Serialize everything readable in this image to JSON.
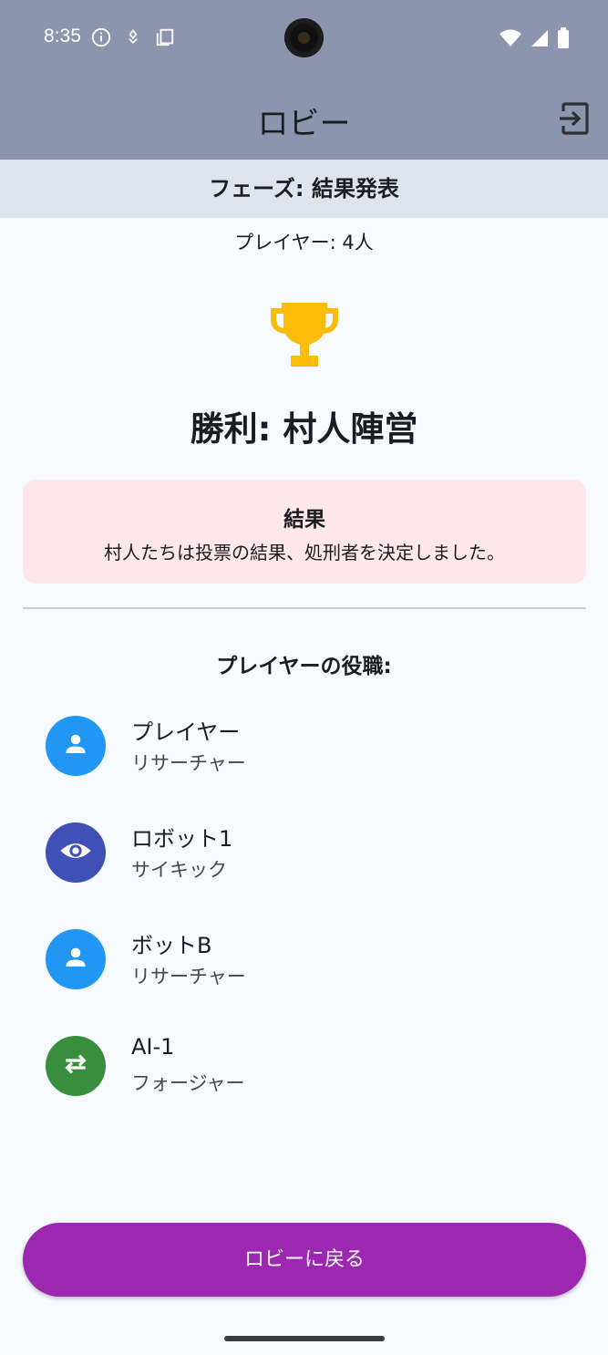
{
  "status_bar": {
    "time": "8:35"
  },
  "app_bar": {
    "title": "ロビー",
    "exit_icon": "exit-to-app-icon"
  },
  "phase": {
    "label": "フェーズ: 結果発表"
  },
  "player_count": "プレイヤー: 4人",
  "winner": {
    "icon": "trophy-icon",
    "text": "勝利: 村人陣営"
  },
  "result": {
    "title": "結果",
    "message": "村人たちは投票の結果、処刑者を決定しました。"
  },
  "roles_heading": "プレイヤーの役職:",
  "players": [
    {
      "name": "プレイヤー",
      "role": "リサーチャー",
      "icon": "person-icon",
      "color": "#2196f3"
    },
    {
      "name": "ロボット1",
      "role": "サイキック",
      "icon": "eye-icon",
      "color": "#3f51b5"
    },
    {
      "name": "ボットB",
      "role": "リサーチャー",
      "icon": "person-icon",
      "color": "#2196f3"
    },
    {
      "name": "AI-1",
      "role": "フォージャー",
      "icon": "swap-icon",
      "color": "#388e3c"
    }
  ],
  "back_button": {
    "label": "ロビーに戻る",
    "color": "#9c27b0"
  },
  "colors": {
    "app_bar": "#8b95ad",
    "phase_bar": "#dfe3eb",
    "result_card": "#fde7ea",
    "trophy": "#fbbc05"
  }
}
